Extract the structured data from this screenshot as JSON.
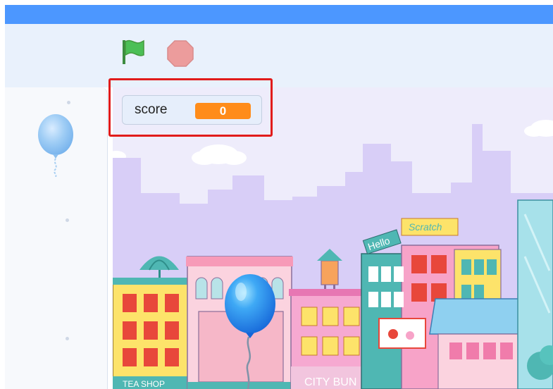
{
  "toolbar": {
    "green_flag_icon": "green-flag-icon",
    "stop_icon": "stop-sign-icon"
  },
  "monitor": {
    "label": "score",
    "value": "0"
  },
  "stage": {
    "signs": {
      "hello": "Hello",
      "scratch": "Scratch",
      "tea_shop": "TEA SHOP",
      "city_bun": "CITY BUN"
    }
  },
  "colors": {
    "menu_bar": "#4c97ff",
    "monitor_value_bg": "#ff8c1a",
    "highlight_box": "#e11b1b",
    "flag_green": "#4cbf56",
    "stop_red": "#ec9c9c"
  }
}
